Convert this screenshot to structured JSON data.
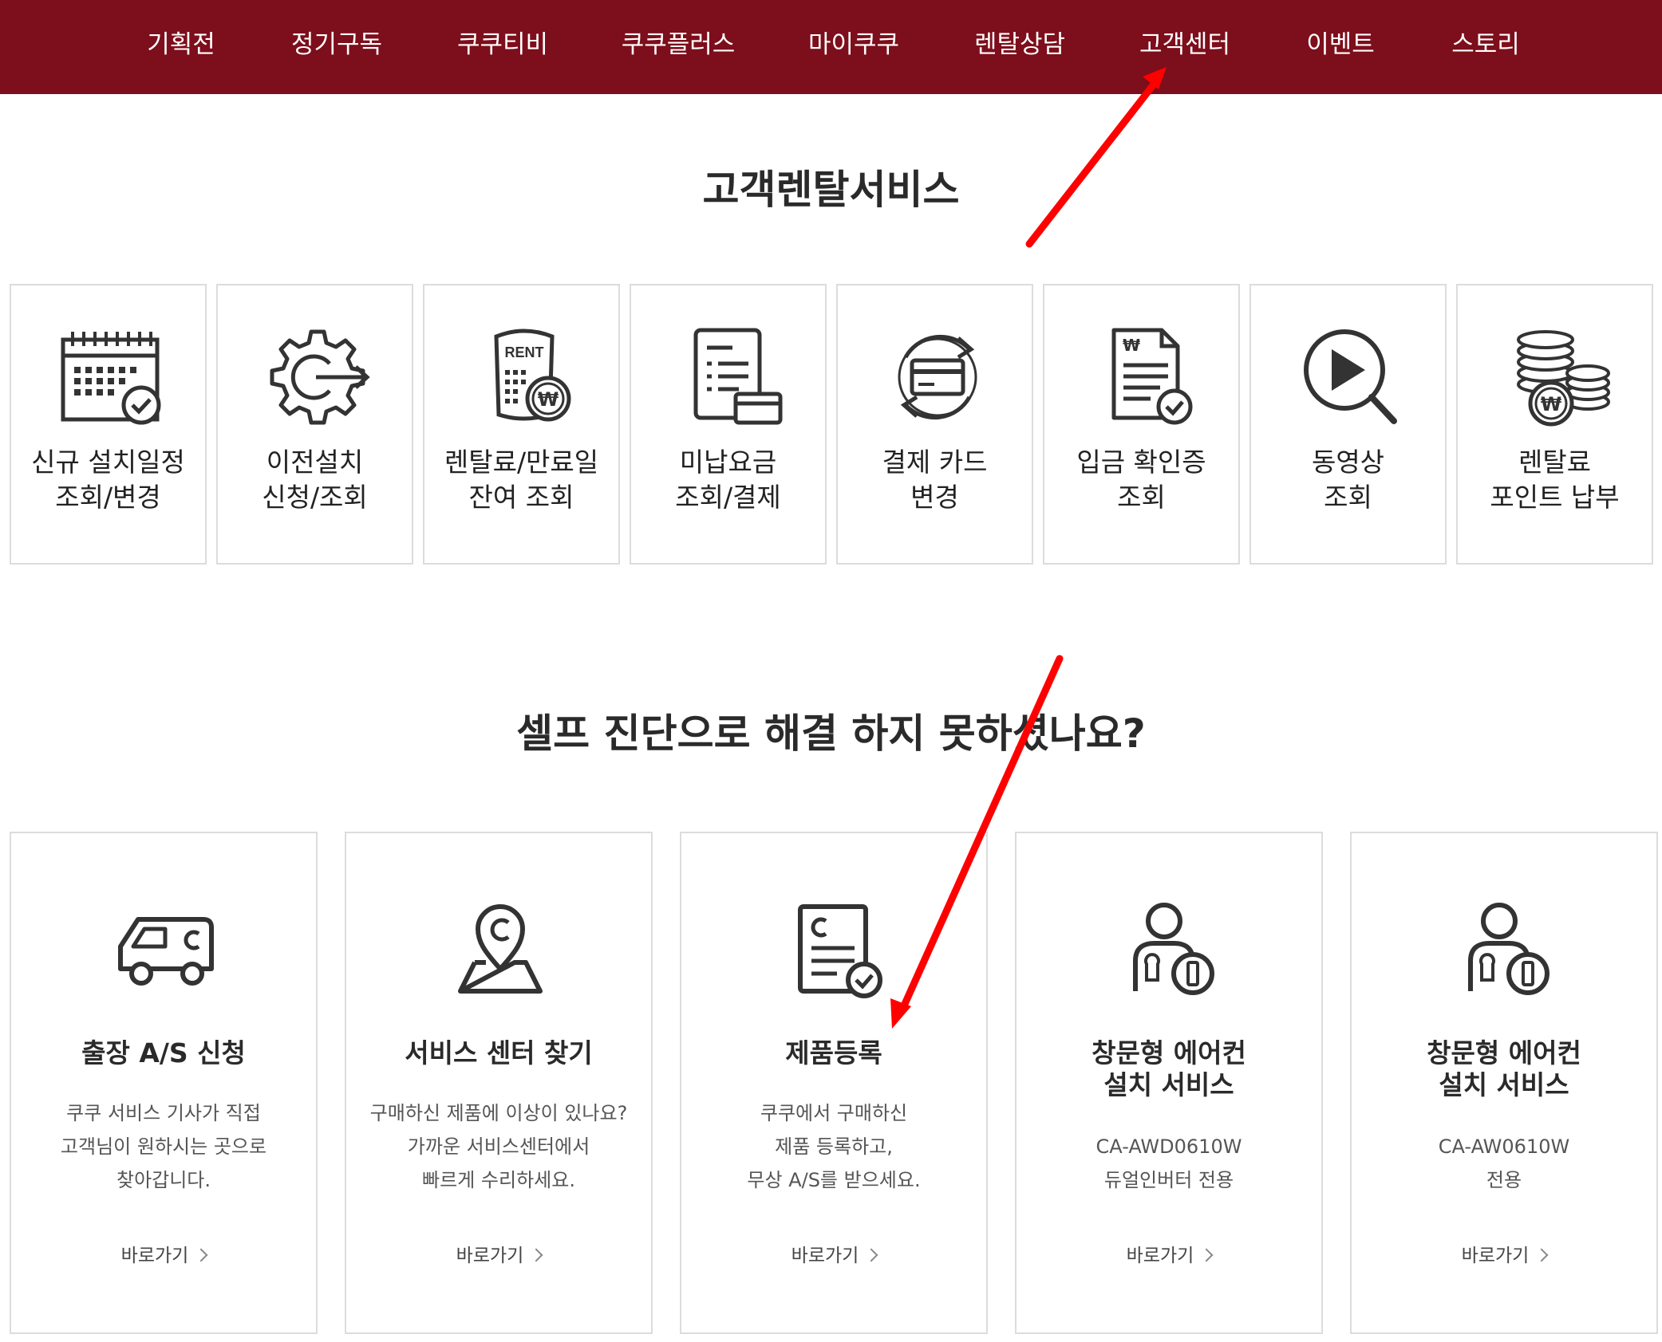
{
  "nav": {
    "items": [
      {
        "label": "기획전"
      },
      {
        "label": "정기구독"
      },
      {
        "label": "쿠쿠티비"
      },
      {
        "label": "쿠쿠플러스"
      },
      {
        "label": "마이쿠쿠"
      },
      {
        "label": "렌탈상담"
      },
      {
        "label": "고객센터"
      },
      {
        "label": "이벤트"
      },
      {
        "label": "스토리"
      }
    ]
  },
  "rental_section": {
    "title": "고객렌탈서비스",
    "cards": [
      {
        "label": "신규 설치일정\n조회/변경",
        "icon": "calendar-check-icon"
      },
      {
        "label": "이전설치\n신청/조회",
        "icon": "gear-arrow-icon"
      },
      {
        "label": "렌탈료/만료일\n잔여 조회",
        "icon": "rent-won-icon"
      },
      {
        "label": "미납요금\n조회/결제",
        "icon": "bill-card-icon"
      },
      {
        "label": "결제 카드\n변경",
        "icon": "card-refresh-icon"
      },
      {
        "label": "입금 확인증\n조회",
        "icon": "won-document-check-icon"
      },
      {
        "label": "동영상\n조회",
        "icon": "video-search-icon"
      },
      {
        "label": "렌탈료\n포인트 납부",
        "icon": "coin-stack-icon"
      }
    ],
    "rent_icon_text": "RENT"
  },
  "help_section": {
    "title": "셀프 진단으로 해결 하지 못하셨나요?",
    "cards": [
      {
        "title": "출장 A/S 신청",
        "desc": "쿠쿠 서비스 기사가 직접\n고객님이 원하시는 곳으로\n찾아갑니다.",
        "link": "바로가기",
        "icon": "service-van-icon"
      },
      {
        "title": "서비스 센터 찾기",
        "desc": "구매하신 제품에 이상이 있나요?\n가까운 서비스센터에서\n빠르게 수리하세요.",
        "link": "바로가기",
        "icon": "location-pin-icon"
      },
      {
        "title": "제품등록",
        "desc": "쿠쿠에서 구매하신\n제품 등록하고,\n무상 A/S를 받으세요.",
        "link": "바로가기",
        "icon": "document-check-icon"
      },
      {
        "title": "창문형 에어컨\n설치 서비스",
        "desc": "CA-AWD0610W\n듀얼인버터 전용",
        "link": "바로가기",
        "icon": "technician-icon"
      },
      {
        "title": "창문형 에어컨\n설치 서비스",
        "desc": "CA-AW0610W\n전용",
        "link": "바로가기",
        "icon": "technician-icon"
      }
    ]
  },
  "colors": {
    "brand": "#7d0e1b",
    "annotation_arrow": "#ff0000"
  }
}
